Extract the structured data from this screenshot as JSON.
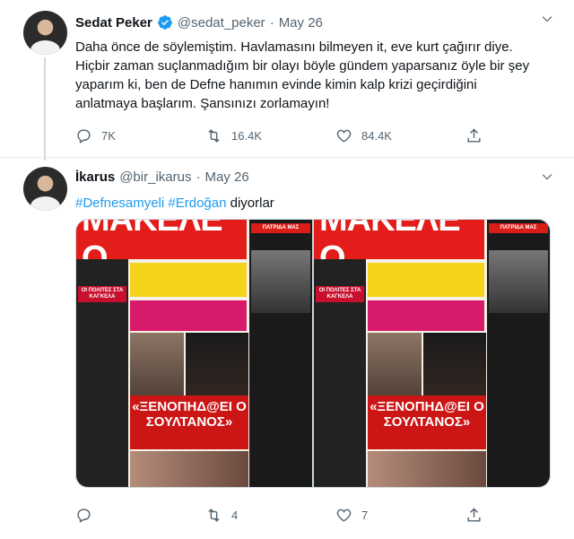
{
  "tweets": [
    {
      "display_name": "Sedat Peker",
      "handle": "@sedat_peker",
      "separator": "·",
      "date": "May 26",
      "lines": [
        "Daha önce de söylemiştim. Havlamasını bilmeyen it, eve kurt çağırır diye.",
        "Hiçbir zaman suçlanmadığım bir olayı böyle gündem yaparsanız öyle bir şey",
        "yaparım ki, ben de Defne hanımın evinde kimin kalp krizi geçirdiğini",
        "anlatmaya başlarım. Şansınızı zorlamayın!"
      ],
      "actions": {
        "reply_count": "7K",
        "retweet_count": "16.4K",
        "like_count": "84.4K",
        "share_count": ""
      }
    },
    {
      "display_name": "İkarus",
      "handle": "@bir_ikarus",
      "separator": "·",
      "date": "May 26",
      "hashtag_1": "#Defnesamyeli",
      "hashtag_2": "#Erdoğan",
      "trailing_text": "diyorlar",
      "actions": {
        "reply_count": "",
        "retweet_count": "4",
        "like_count": "7",
        "share_count": ""
      },
      "media": {
        "masthead": "ΜΑΚΕΛΕ Ο",
        "headline": "«ΞΕΝΟΠΗΔ@ΕΙ Ο ΣΟΥΛΤΑΝΟΣ»",
        "side_top": "ΠΑΤΡΙΔΑ ΜΑΣ",
        "left_top": "ΟΙ ΠΟΛΙΤΕΣ ΣΤΑ ΚΑΓΚΕΛΑ",
        "count": 2
      }
    }
  ],
  "colors": {
    "accent": "#1d9bf0",
    "text": "#0f1419",
    "muted": "#536471",
    "masthead_red": "#e31d1a"
  },
  "icons": {
    "verified": "verified-badge-icon",
    "more": "more-options-icon",
    "reply": "reply-icon",
    "retweet": "retweet-icon",
    "like": "heart-icon",
    "share": "share-icon"
  }
}
